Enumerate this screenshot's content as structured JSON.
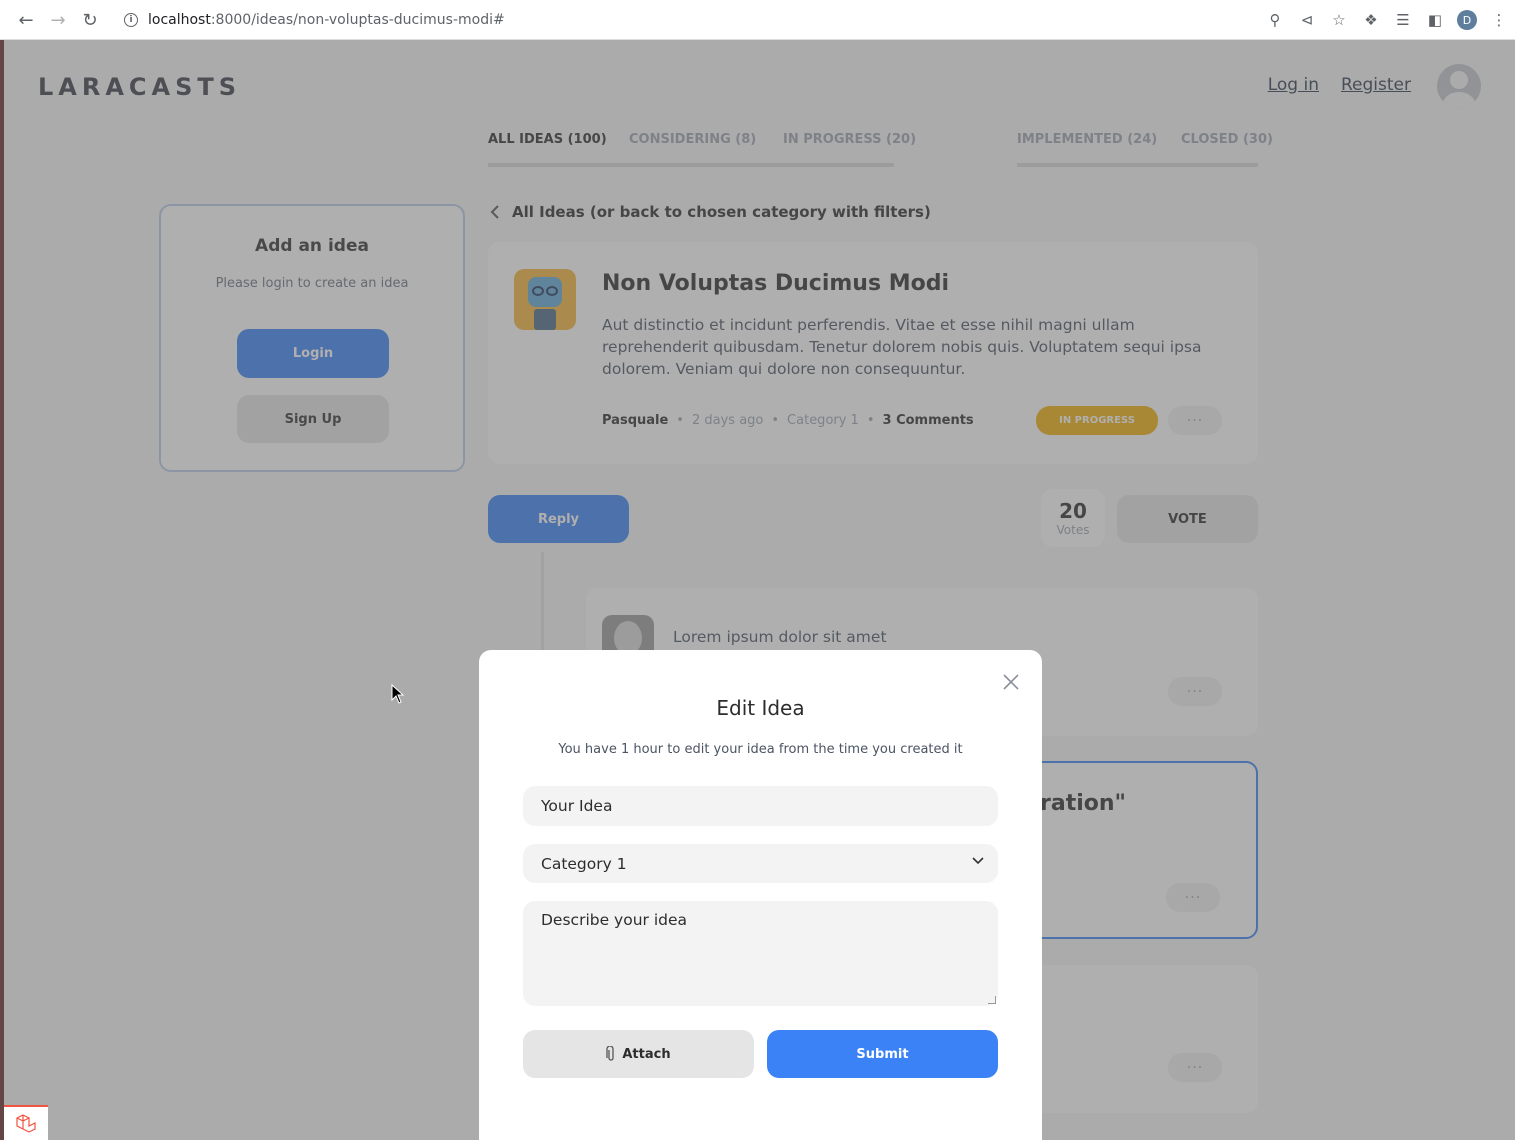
{
  "browser": {
    "url_host": "localhost",
    "url_path": ":8000/ideas/non-voluptas-ducimus-modi#",
    "profile_initial": "D"
  },
  "header": {
    "logo": "LARACASTS",
    "login": "Log in",
    "register": "Register"
  },
  "tabs": [
    {
      "label": "ALL IDEAS (100)",
      "active": true
    },
    {
      "label": "CONSIDERING (8)",
      "active": false
    },
    {
      "label": "IN PROGRESS (20)",
      "active": false
    },
    {
      "label": "IMPLEMENTED (24)",
      "active": false
    },
    {
      "label": "CLOSED (30)",
      "active": false
    }
  ],
  "sidebar": {
    "title": "Add an idea",
    "subtitle": "Please login to create an idea",
    "login_label": "Login",
    "signup_label": "Sign Up"
  },
  "back_link": "All Ideas (or back to chosen category with filters)",
  "idea": {
    "title": "Non Voluptas Ducimus Modi",
    "description": "Aut distinctio et incidunt perferendis. Vitae et esse nihil magni ullam reprehenderit quibusdam. Tenetur dolorem nobis quis. Voluptatem sequi ipsa dolorem. Veniam qui dolore non consequuntur.",
    "author": "Pasquale",
    "time": "2 days ago",
    "category": "Category 1",
    "comments": "3 Comments",
    "status": "IN PROGRESS",
    "more": "···"
  },
  "actions": {
    "reply_label": "Reply",
    "votes_count": "20",
    "votes_label": "Votes",
    "vote_label": "VOTE"
  },
  "comments": [
    {
      "text": "Lorem ipsum dolor sit amet"
    },
    {
      "title_fragment": "ration\""
    }
  ],
  "modal": {
    "title": "Edit Idea",
    "subtitle": "You have 1 hour to edit your idea from the time you created it",
    "title_placeholder": "Your Idea",
    "category_value": "Category 1",
    "description_placeholder": "Describe your idea",
    "attach_label": "Attach",
    "submit_label": "Submit"
  },
  "colors": {
    "accent": "#3b82f6",
    "status_in_progress": "#f1ae0a"
  }
}
